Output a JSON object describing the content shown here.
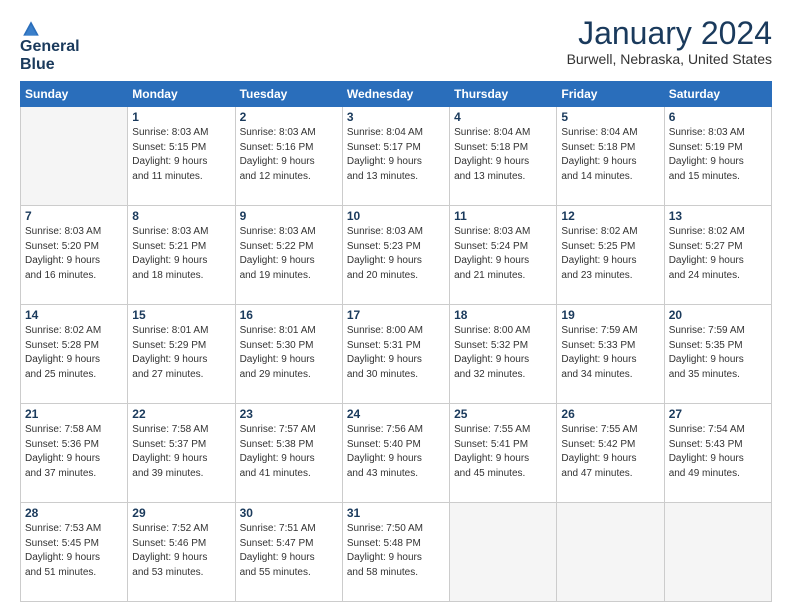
{
  "logo": {
    "line1": "General",
    "line2": "Blue"
  },
  "title": "January 2024",
  "subtitle": "Burwell, Nebraska, United States",
  "weekdays": [
    "Sunday",
    "Monday",
    "Tuesday",
    "Wednesday",
    "Thursday",
    "Friday",
    "Saturday"
  ],
  "weeks": [
    [
      {
        "day": "",
        "info": ""
      },
      {
        "day": "1",
        "info": "Sunrise: 8:03 AM\nSunset: 5:15 PM\nDaylight: 9 hours\nand 11 minutes."
      },
      {
        "day": "2",
        "info": "Sunrise: 8:03 AM\nSunset: 5:16 PM\nDaylight: 9 hours\nand 12 minutes."
      },
      {
        "day": "3",
        "info": "Sunrise: 8:04 AM\nSunset: 5:17 PM\nDaylight: 9 hours\nand 13 minutes."
      },
      {
        "day": "4",
        "info": "Sunrise: 8:04 AM\nSunset: 5:18 PM\nDaylight: 9 hours\nand 13 minutes."
      },
      {
        "day": "5",
        "info": "Sunrise: 8:04 AM\nSunset: 5:18 PM\nDaylight: 9 hours\nand 14 minutes."
      },
      {
        "day": "6",
        "info": "Sunrise: 8:03 AM\nSunset: 5:19 PM\nDaylight: 9 hours\nand 15 minutes."
      }
    ],
    [
      {
        "day": "7",
        "info": "Sunrise: 8:03 AM\nSunset: 5:20 PM\nDaylight: 9 hours\nand 16 minutes."
      },
      {
        "day": "8",
        "info": "Sunrise: 8:03 AM\nSunset: 5:21 PM\nDaylight: 9 hours\nand 18 minutes."
      },
      {
        "day": "9",
        "info": "Sunrise: 8:03 AM\nSunset: 5:22 PM\nDaylight: 9 hours\nand 19 minutes."
      },
      {
        "day": "10",
        "info": "Sunrise: 8:03 AM\nSunset: 5:23 PM\nDaylight: 9 hours\nand 20 minutes."
      },
      {
        "day": "11",
        "info": "Sunrise: 8:03 AM\nSunset: 5:24 PM\nDaylight: 9 hours\nand 21 minutes."
      },
      {
        "day": "12",
        "info": "Sunrise: 8:02 AM\nSunset: 5:25 PM\nDaylight: 9 hours\nand 23 minutes."
      },
      {
        "day": "13",
        "info": "Sunrise: 8:02 AM\nSunset: 5:27 PM\nDaylight: 9 hours\nand 24 minutes."
      }
    ],
    [
      {
        "day": "14",
        "info": "Sunrise: 8:02 AM\nSunset: 5:28 PM\nDaylight: 9 hours\nand 25 minutes."
      },
      {
        "day": "15",
        "info": "Sunrise: 8:01 AM\nSunset: 5:29 PM\nDaylight: 9 hours\nand 27 minutes."
      },
      {
        "day": "16",
        "info": "Sunrise: 8:01 AM\nSunset: 5:30 PM\nDaylight: 9 hours\nand 29 minutes."
      },
      {
        "day": "17",
        "info": "Sunrise: 8:00 AM\nSunset: 5:31 PM\nDaylight: 9 hours\nand 30 minutes."
      },
      {
        "day": "18",
        "info": "Sunrise: 8:00 AM\nSunset: 5:32 PM\nDaylight: 9 hours\nand 32 minutes."
      },
      {
        "day": "19",
        "info": "Sunrise: 7:59 AM\nSunset: 5:33 PM\nDaylight: 9 hours\nand 34 minutes."
      },
      {
        "day": "20",
        "info": "Sunrise: 7:59 AM\nSunset: 5:35 PM\nDaylight: 9 hours\nand 35 minutes."
      }
    ],
    [
      {
        "day": "21",
        "info": "Sunrise: 7:58 AM\nSunset: 5:36 PM\nDaylight: 9 hours\nand 37 minutes."
      },
      {
        "day": "22",
        "info": "Sunrise: 7:58 AM\nSunset: 5:37 PM\nDaylight: 9 hours\nand 39 minutes."
      },
      {
        "day": "23",
        "info": "Sunrise: 7:57 AM\nSunset: 5:38 PM\nDaylight: 9 hours\nand 41 minutes."
      },
      {
        "day": "24",
        "info": "Sunrise: 7:56 AM\nSunset: 5:40 PM\nDaylight: 9 hours\nand 43 minutes."
      },
      {
        "day": "25",
        "info": "Sunrise: 7:55 AM\nSunset: 5:41 PM\nDaylight: 9 hours\nand 45 minutes."
      },
      {
        "day": "26",
        "info": "Sunrise: 7:55 AM\nSunset: 5:42 PM\nDaylight: 9 hours\nand 47 minutes."
      },
      {
        "day": "27",
        "info": "Sunrise: 7:54 AM\nSunset: 5:43 PM\nDaylight: 9 hours\nand 49 minutes."
      }
    ],
    [
      {
        "day": "28",
        "info": "Sunrise: 7:53 AM\nSunset: 5:45 PM\nDaylight: 9 hours\nand 51 minutes."
      },
      {
        "day": "29",
        "info": "Sunrise: 7:52 AM\nSunset: 5:46 PM\nDaylight: 9 hours\nand 53 minutes."
      },
      {
        "day": "30",
        "info": "Sunrise: 7:51 AM\nSunset: 5:47 PM\nDaylight: 9 hours\nand 55 minutes."
      },
      {
        "day": "31",
        "info": "Sunrise: 7:50 AM\nSunset: 5:48 PM\nDaylight: 9 hours\nand 58 minutes."
      },
      {
        "day": "",
        "info": ""
      },
      {
        "day": "",
        "info": ""
      },
      {
        "day": "",
        "info": ""
      }
    ]
  ]
}
